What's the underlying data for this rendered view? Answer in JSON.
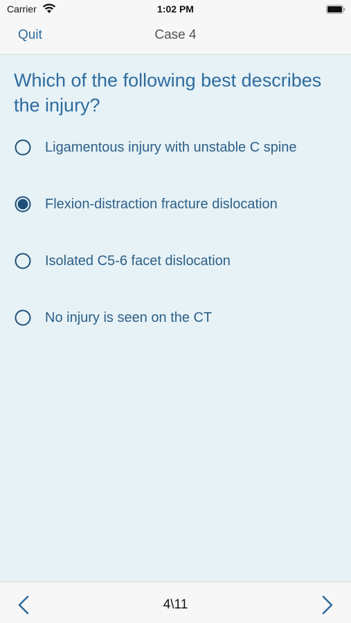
{
  "status_bar": {
    "carrier": "Carrier",
    "time": "1:02 PM",
    "wifi_icon": "wifi-icon",
    "battery_icon": "battery-icon"
  },
  "nav": {
    "quit_label": "Quit",
    "title": "Case 4"
  },
  "question": {
    "text": "Which of the following best describes the injury?"
  },
  "options": [
    {
      "label": "Ligamentous injury with unstable C spine",
      "selected": false
    },
    {
      "label": "Flexion-distraction fracture dislocation",
      "selected": true
    },
    {
      "label": "Isolated C5-6 facet dislocation",
      "selected": false
    },
    {
      "label": "No injury is seen on the CT",
      "selected": false
    }
  ],
  "footer": {
    "page_indicator": "4\\11",
    "prev_icon": "chevron-left-icon",
    "next_icon": "chevron-right-icon"
  },
  "colors": {
    "accent": "#2e6b9e",
    "option_text": "#2e5f87",
    "radio_selected": "#1f4f78",
    "background": "#e6f2f6",
    "bar_background": "#f7f7f7"
  }
}
